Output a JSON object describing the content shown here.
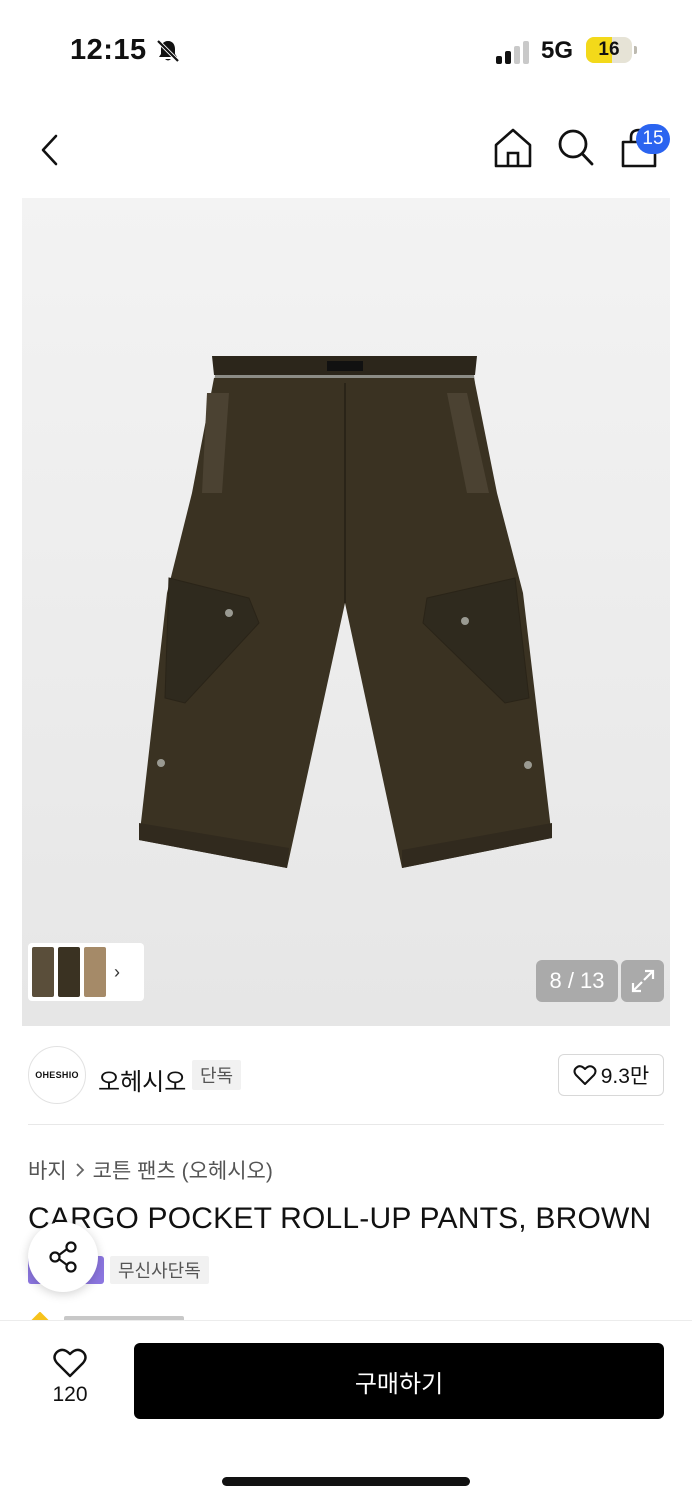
{
  "status_bar": {
    "time": "12:15",
    "network": "5G",
    "battery": "16",
    "bell_icon": "bell-slash-icon",
    "signal_icon": "cellular-signal-icon"
  },
  "nav": {
    "back_icon": "chevron-left-icon",
    "home_icon": "home-icon",
    "search_icon": "search-icon",
    "cart_icon": "shopping-bag-icon",
    "cart_count": "15"
  },
  "gallery": {
    "counter": "8 / 13",
    "expand_icon": "expand-icon",
    "thumb_chevron": "›"
  },
  "brand": {
    "logo_text": "OHESHIO",
    "name": "오헤시오",
    "exclusive_tag": "단독",
    "like_count": "9.3만"
  },
  "product": {
    "breadcrumb": [
      "바지",
      "코튼 팬츠 (오헤시오)"
    ],
    "title": "CARGO POCKET ROLL-UP PANTS, BROWN",
    "badge_exclusive": "무신사단독"
  },
  "bottom_bar": {
    "like_count": "120",
    "buy_label": "구매하기"
  },
  "colors": {
    "accent_blue": "#2b64f0",
    "pants_brown": "#3a3222",
    "purple_badge": "#8c76e0",
    "star_yellow": "#f6c21c"
  }
}
